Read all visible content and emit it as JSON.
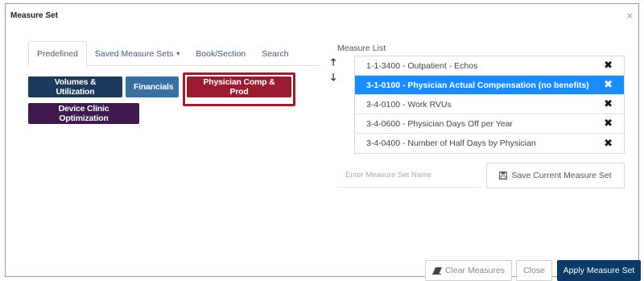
{
  "modal": {
    "title": "Measure Set",
    "close_glyph": "×"
  },
  "tabs": [
    {
      "label": "Predefined",
      "active": true
    },
    {
      "label": "Saved Measure Sets",
      "caret": "▾"
    },
    {
      "label": "Book/Section"
    },
    {
      "label": "Search"
    }
  ],
  "categories": [
    {
      "label": "Volumes & Utilization",
      "color": "#1b3a5c"
    },
    {
      "label": "Financials",
      "color": "#3a6fa1"
    },
    {
      "label": "Physician Comp & Prod",
      "color": "#9b1b30"
    },
    {
      "label": "Device Clinic Optimization",
      "color": "#3e1a4f"
    }
  ],
  "measure_list": {
    "label": "Measure List",
    "move_up_glyph": "🡑",
    "move_down_glyph": "🡓",
    "items": [
      {
        "label": "1-1-3400 - Outpatient - Echos",
        "selected": false
      },
      {
        "label": "3-1-0100 - Physician Actual Compensation (no benefits)",
        "selected": true
      },
      {
        "label": "3-4-0100 - Work RVUs",
        "selected": false
      },
      {
        "label": "3-4-0600 - Physician Days Off per Year",
        "selected": false
      },
      {
        "label": "3-4-0400 - Number of Half Days by Physician",
        "selected": false
      }
    ],
    "remove_glyph": "✖"
  },
  "name_input": {
    "placeholder": "Enter Measure Set Name",
    "value": ""
  },
  "save_button": {
    "label": "Save Current Measure Set",
    "icon": "save-icon"
  },
  "footer": {
    "clear_label": "Clear Measures",
    "clear_icon": "eraser-icon",
    "close_label": "Close",
    "apply_label": "Apply Measure Set"
  },
  "colors": {
    "selected_row": "#1a8cff",
    "apply_button": "#0b3a66",
    "highlight": "#9b1b30"
  }
}
